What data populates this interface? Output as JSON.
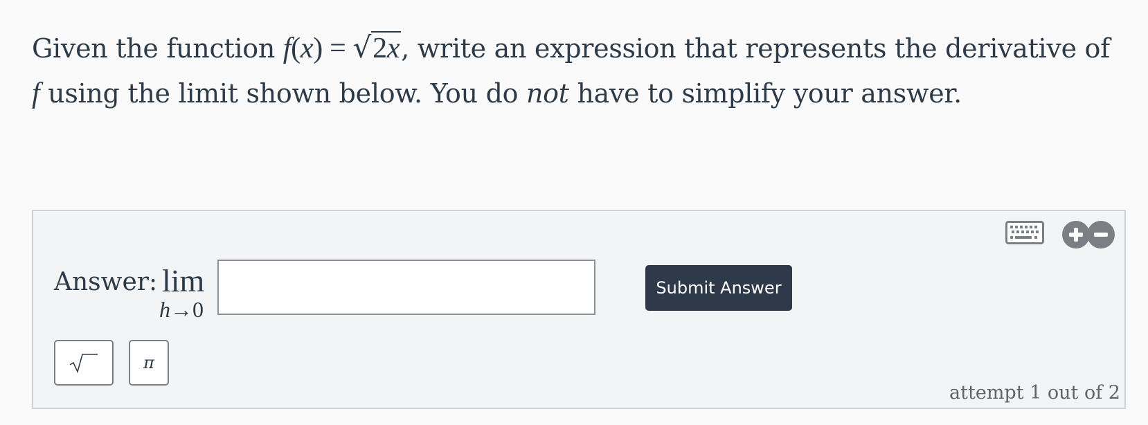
{
  "question": {
    "intro": "Given the function ",
    "func_name": "f",
    "open_paren": "(",
    "var": "x",
    "close_paren": ")",
    "equals": " = ",
    "sqrt_arg_num": "2",
    "sqrt_arg_var": "x",
    "after_func": ", write an expression that represents the derivative of ",
    "func_ref": "f",
    "middle": " using the limit shown below. You do ",
    "emphasis": "not",
    "end": " have to simplify your answer."
  },
  "toolbar": {
    "keyboard_icon": "keyboard-icon",
    "zoom_in_icon": "plus-circle-icon",
    "zoom_out_icon": "minus-circle-icon"
  },
  "answer": {
    "label": "Answer:",
    "lim_word": "lim",
    "lim_var": "h",
    "lim_arrow": "→",
    "lim_target": "0",
    "input_value": "",
    "submit_label": "Submit Answer"
  },
  "tools": {
    "sqrt_icon": "sqrt-icon",
    "pi_label": "π"
  },
  "attempt_text": "attempt 1 out of 2",
  "colors": {
    "text": "#2d3b48",
    "panel_bg": "#f3f4f6",
    "panel_border": "#cfd3d8",
    "button_bg": "#2e3a4a",
    "icon_gray": "#7b7f84"
  }
}
